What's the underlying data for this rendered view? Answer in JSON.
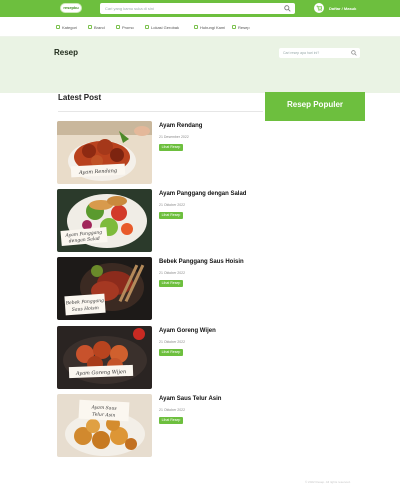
{
  "header": {
    "logo_text": "resepku",
    "search_placeholder": "Cari yang kamu suka di sini",
    "login_label": "Daftar / Masuk"
  },
  "nav": {
    "items": [
      {
        "label": "Kategori"
      },
      {
        "label": "Brand"
      },
      {
        "label": "Promo"
      },
      {
        "label": "Lokasi Gerobak"
      },
      {
        "label": "Hubungi Kami"
      },
      {
        "label": "Resep"
      }
    ]
  },
  "hero": {
    "title": "Resep",
    "search_placeholder": "Cari resep apa hari ini?"
  },
  "main": {
    "section_title": "Latest Post",
    "button_label": "Lihat Resep",
    "posts": [
      {
        "title": "Ayam Rendang",
        "date": "21 Desember 2022",
        "overlay": "Ayam Rendang"
      },
      {
        "title": "Ayam Panggang dengan Salad",
        "date": "21 Oktober 2022",
        "overlay": "Ayam Panggang dengan Salad"
      },
      {
        "title": "Bebek Panggang Saus Hoisin",
        "date": "21 Oktober 2022",
        "overlay": "Bebek Panggang Saus Hoisin"
      },
      {
        "title": "Ayam Goreng Wijen",
        "date": "21 Oktober 2022",
        "overlay": "Ayam Goreng Wijen"
      },
      {
        "title": "Ayam Saus Telur Asin",
        "date": "21 Oktober 2022",
        "overlay": "Ayam Saus Telur Asin"
      }
    ]
  },
  "sidebar": {
    "title": "Resep Populer"
  },
  "footer": {
    "copyright": "© 2022 Resep. All rights reserved."
  },
  "colors": {
    "brand_green": "#6dbf3e",
    "hero_bg": "#eaf3e4"
  }
}
